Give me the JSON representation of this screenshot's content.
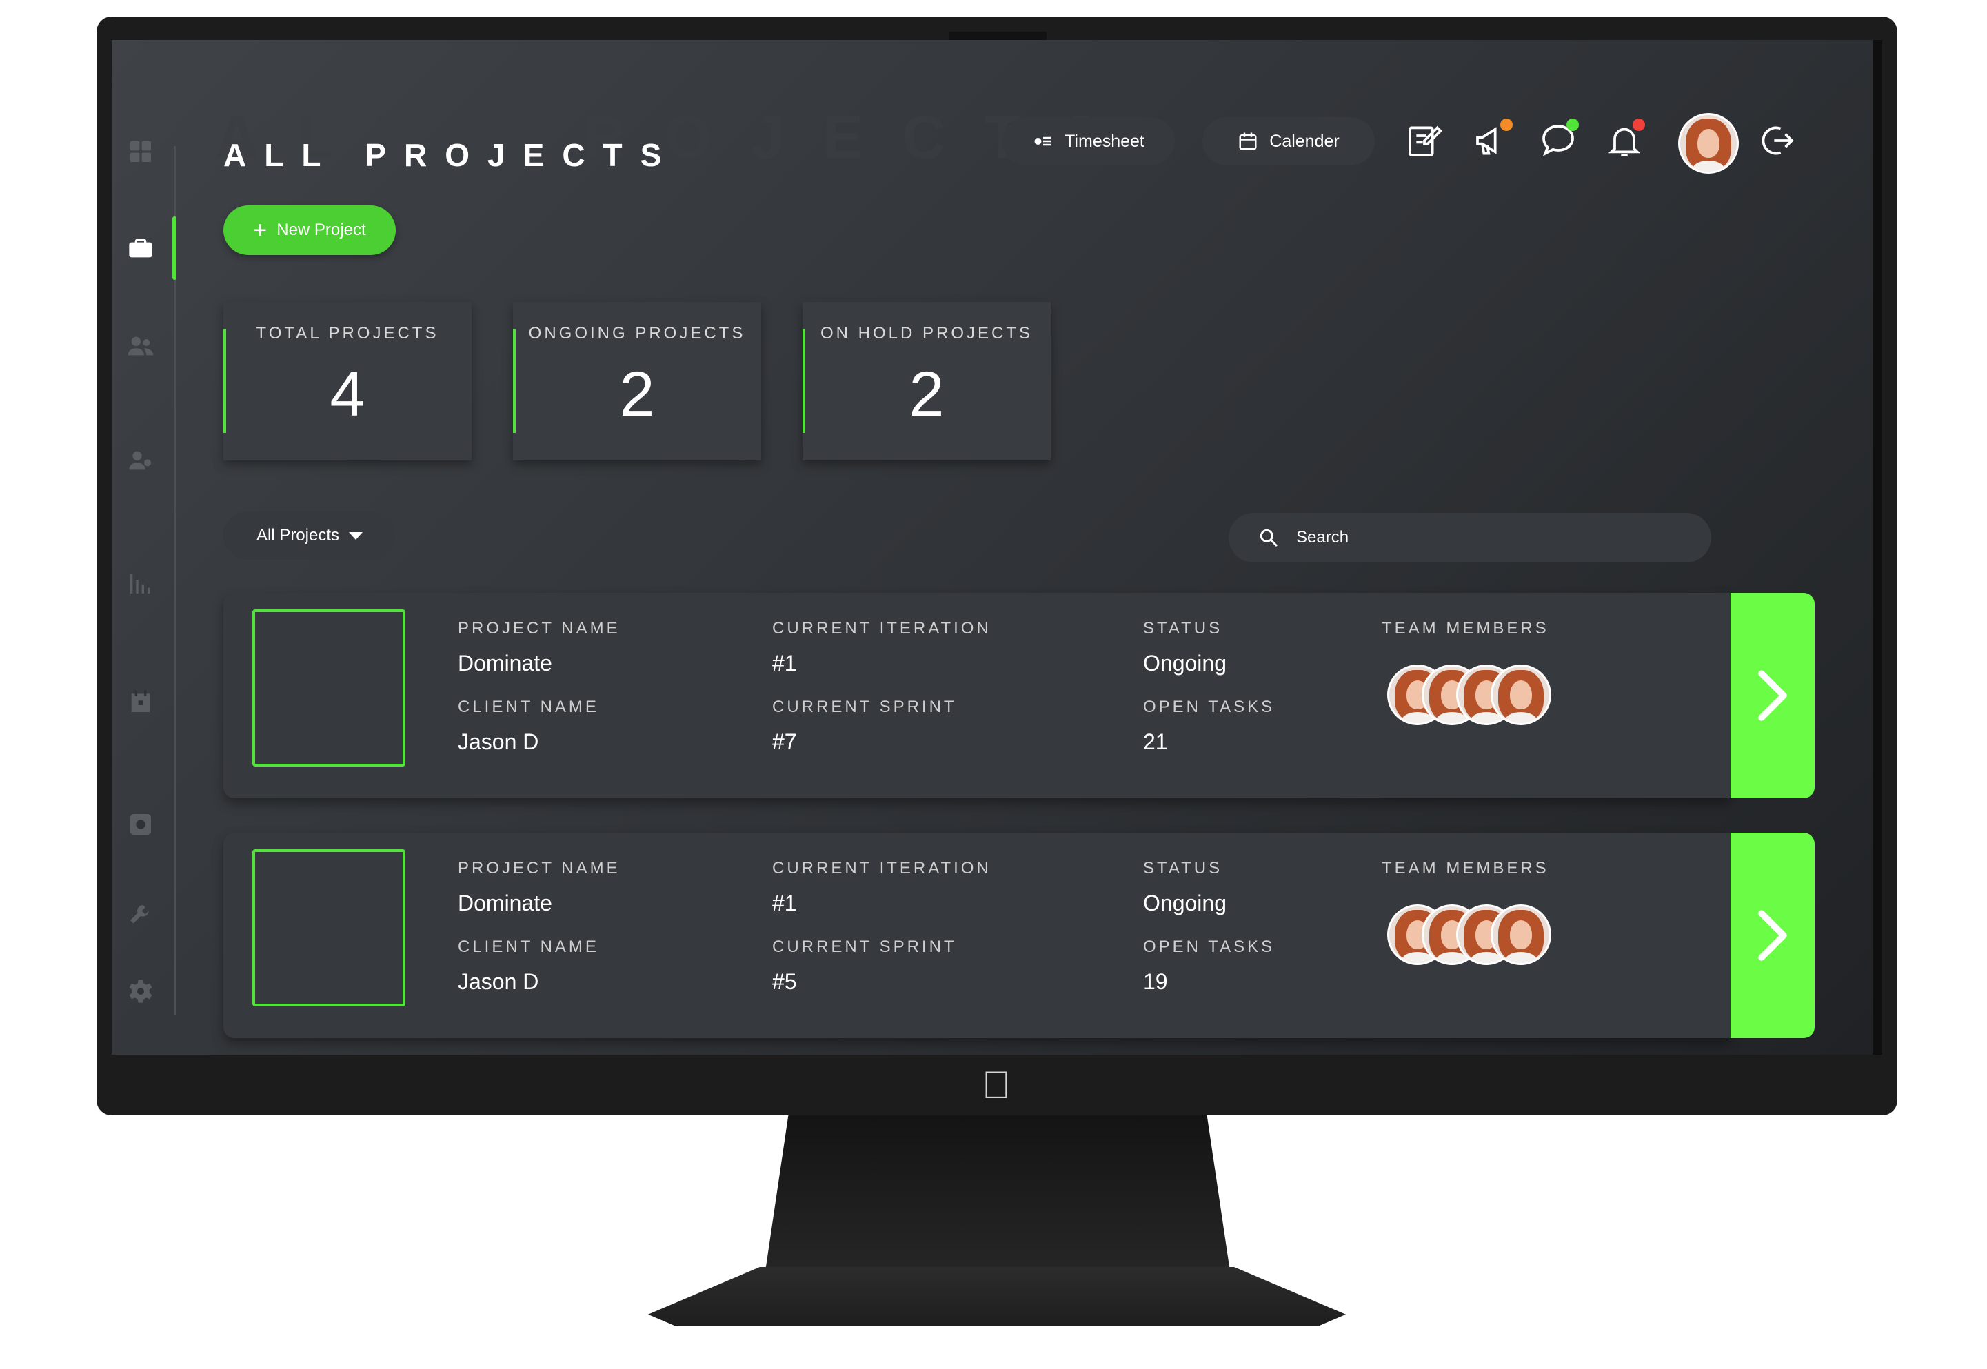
{
  "header": {
    "ghost_title": "ALL PROJECTS",
    "title": "ALL PROJECTS",
    "timesheet_label": "Timesheet",
    "calendar_label": "Calender"
  },
  "actions": {
    "new_project_label": "New Project"
  },
  "stats": [
    {
      "label": "TOTAL PROJECTS",
      "value": "4"
    },
    {
      "label": "ONGOING PROJECTS",
      "value": "2"
    },
    {
      "label": "ON HOLD PROJECTS",
      "value": "2"
    }
  ],
  "filter": {
    "selected": "All Projects"
  },
  "search": {
    "placeholder": "Search"
  },
  "labels": {
    "project_name": "PROJECT NAME",
    "client_name": "CLIENT NAME",
    "current_iteration": "CURRENT ITERATION",
    "current_sprint": "CURRENT SPRINT",
    "status": "STATUS",
    "open_tasks": "OPEN TASKS",
    "team_members": "TEAM MEMBERS"
  },
  "projects": [
    {
      "project_name": "Dominate",
      "client_name": "Jason D",
      "current_iteration": "#1",
      "current_sprint": "#7",
      "status": "Ongoing",
      "open_tasks": "21"
    },
    {
      "project_name": "Dominate",
      "client_name": "Jason D",
      "current_iteration": "#1",
      "current_sprint": "#5",
      "status": "Ongoing",
      "open_tasks": "19"
    }
  ],
  "colors": {
    "accent": "#52e33a",
    "go_button": "#6bfd45",
    "badge_orange": "#f28c28",
    "badge_green": "#52e33a",
    "badge_red": "#f2413a"
  },
  "icons": {
    "sidebar": [
      "grid-icon",
      "briefcase-icon",
      "users-icon",
      "user-settings-icon",
      "bar-chart-icon",
      "calendar-icon",
      "record-icon",
      "wrench-icon",
      "gear-icon"
    ],
    "topbar": [
      "edit-icon",
      "megaphone-icon",
      "chat-icon",
      "bell-icon",
      "logout-icon"
    ]
  }
}
